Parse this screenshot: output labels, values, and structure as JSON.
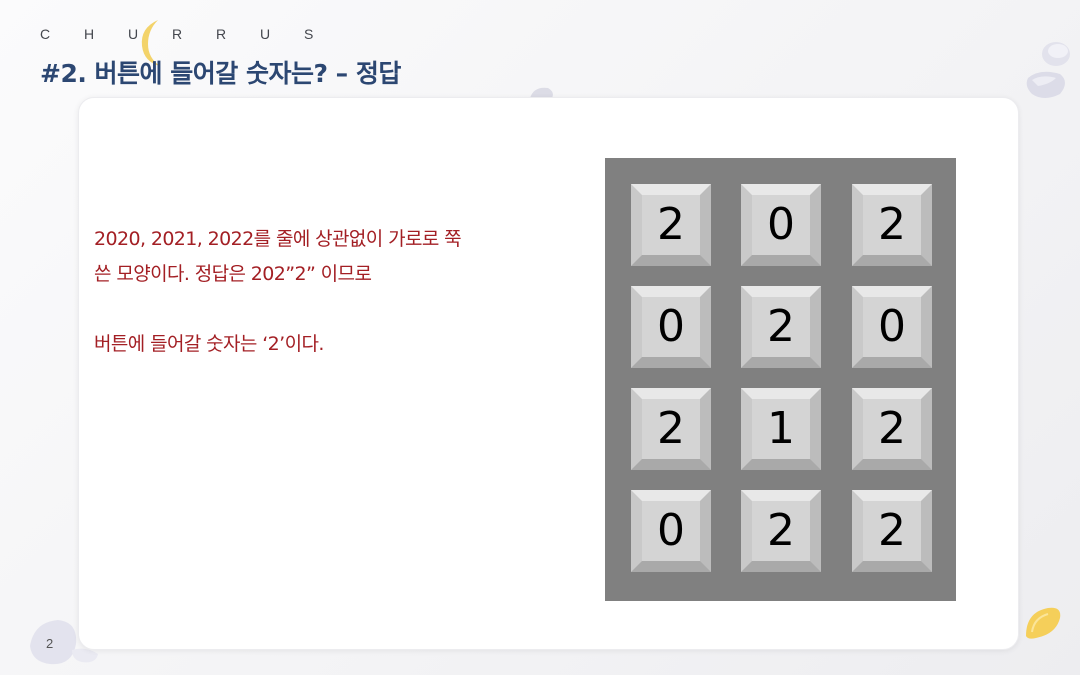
{
  "header": {
    "brand": "C H U R R U S",
    "title": "#2. 버튼에 들어갈 숫자는? – 정답"
  },
  "content": {
    "line1": "2020, 2021, 2022를 줄에 상관없이 가로로 쭉",
    "line2": "쓴 모양이다. 정답은 202”2” 이므로",
    "line3": "버튼에 들어갈 숫자는 ‘2’이다."
  },
  "keypad": {
    "rows": [
      [
        "2",
        "0",
        "2"
      ],
      [
        "0",
        "2",
        "0"
      ],
      [
        "2",
        "1",
        "2"
      ],
      [
        "0",
        "2",
        "2"
      ]
    ]
  },
  "footer": {
    "page_number": "2"
  },
  "colors": {
    "title": "#2c4772",
    "body_text": "#a31f24",
    "keypad_bg": "#808080",
    "key_face": "#d4d4d4",
    "moon": "#f3d36a"
  },
  "icons": [
    "moon-icon",
    "stone-decoration",
    "lemon-decoration"
  ]
}
